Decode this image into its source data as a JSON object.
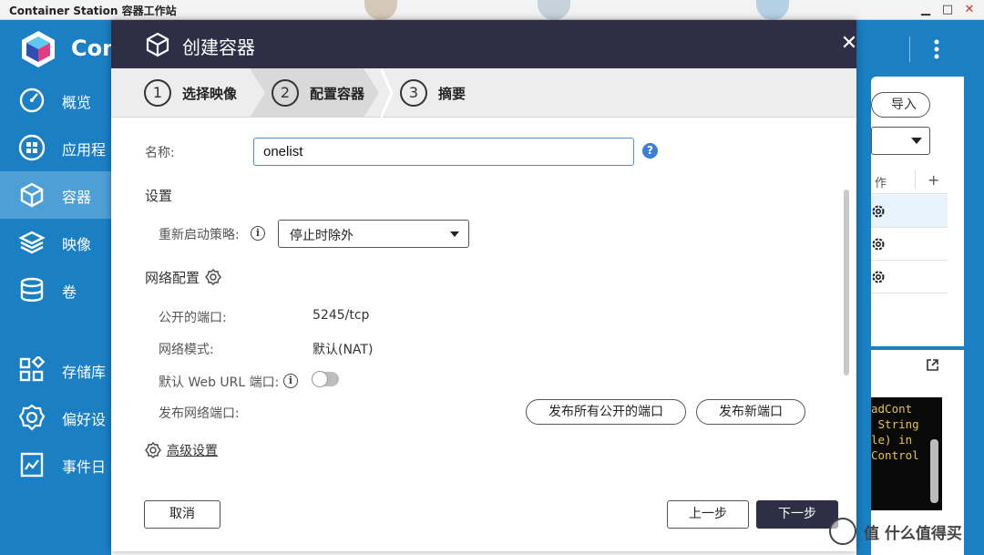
{
  "app": {
    "window_title": "Container Station 容器工作站",
    "brand_name": "Con",
    "brand_colors": {
      "sidebar": "#1b7fc4",
      "dialog_header": "#2f2e47",
      "accent": "#3a7fd8"
    }
  },
  "sidebar": {
    "items": [
      {
        "label": "概览",
        "icon": "dashboard-gauge-icon"
      },
      {
        "label": "应用程",
        "icon": "apps-grid-icon"
      },
      {
        "label": "容器",
        "icon": "container-cube-icon",
        "active": true
      },
      {
        "label": "映像",
        "icon": "image-layers-icon"
      },
      {
        "label": "卷",
        "icon": "volume-database-icon"
      },
      {
        "label": "存储库",
        "icon": "repository-icon"
      },
      {
        "label": "偏好设",
        "icon": "preferences-gear-icon"
      },
      {
        "label": "事件日",
        "icon": "event-log-icon"
      }
    ]
  },
  "background": {
    "import_label": "导入",
    "column_header": "作",
    "add_label": "+",
    "terminal_lines": [
      "adCont",
      " String",
      "le) in",
      "Control"
    ]
  },
  "dialog": {
    "title": "创建容器",
    "close_label": "✕",
    "steps": [
      {
        "num": "1",
        "label": "选择映像"
      },
      {
        "num": "2",
        "label": "配置容器",
        "active": true
      },
      {
        "num": "3",
        "label": "摘要"
      }
    ],
    "name": {
      "label": "名称:",
      "value": "onelist",
      "help": "?"
    },
    "settings": {
      "title": "设置",
      "restart_policy_label": "重新启动策略:",
      "restart_policy_value": "停止时除外",
      "info": "i"
    },
    "network": {
      "title": "网络配置",
      "exposed_ports_label": "公开的端口:",
      "exposed_ports_value": "5245/tcp",
      "mode_label": "网络模式:",
      "mode_value": "默认(NAT)",
      "web_url_label": "默认 Web URL 端口:",
      "web_url_enabled": false,
      "publish_label": "发布网络端口:",
      "publish_all_button": "发布所有公开的端口",
      "publish_new_button": "发布新端口"
    },
    "advanced_link": "高级设置",
    "footer": {
      "cancel": "取消",
      "prev": "上一步",
      "next": "下一步"
    }
  },
  "watermark": {
    "text": "值 什么值得买"
  }
}
